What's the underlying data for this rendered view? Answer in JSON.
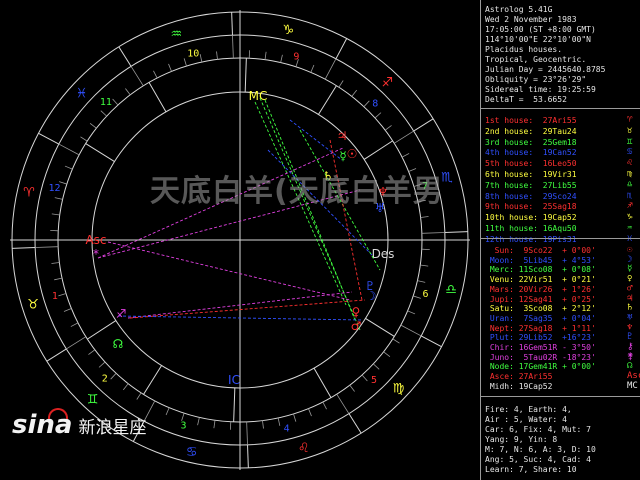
{
  "header": {
    "lines": [
      "Astrolog 5.41G",
      "Wed 2 November 1983",
      "17:05:00 (ST +8:00 GMT)",
      "114°10'00\"E 22°10'00\"N",
      "Placidus houses.",
      "Tropical, Geocentric.",
      "Julian Day = 2445640.8785",
      "Obliquity = 23°26'29\"",
      "Sidereal time: 19:25:59",
      "DeltaT =  53.6652"
    ]
  },
  "houses": [
    {
      "label": "1st house:",
      "value": "27Ari55",
      "color": "#ff3030",
      "glyph": "♈"
    },
    {
      "label": "2nd house:",
      "value": "29Tau24",
      "color": "#ffff40",
      "glyph": "♉"
    },
    {
      "label": "3rd house:",
      "value": "25Gem18",
      "color": "#40ff40",
      "glyph": "♊"
    },
    {
      "label": "4th house:",
      "value": "19Can52",
      "color": "#3050ff",
      "glyph": "♋"
    },
    {
      "label": "5th house:",
      "value": "16Leo50",
      "color": "#ff3030",
      "glyph": "♌"
    },
    {
      "label": "6th house:",
      "value": "19Vir31",
      "color": "#ffff40",
      "glyph": "♍"
    },
    {
      "label": "7th house:",
      "value": "27Lib55",
      "color": "#40ff40",
      "glyph": "♎"
    },
    {
      "label": "8th house:",
      "value": "29Sco24",
      "color": "#3050ff",
      "glyph": "♏"
    },
    {
      "label": "9th house:",
      "value": "25Sag18",
      "color": "#ff3030",
      "glyph": "♐"
    },
    {
      "label": "10th house:",
      "value": "19Cap52",
      "color": "#ffff40",
      "glyph": "♑"
    },
    {
      "label": "11th house:",
      "value": "16Aqu50",
      "color": "#40ff40",
      "glyph": "♒"
    },
    {
      "label": "12th house:",
      "value": "19Pis31",
      "color": "#3050ff",
      "glyph": "♓"
    }
  ],
  "planets": [
    {
      "name": "Sun:",
      "pos": "  9Sco22",
      "aspect": " + 0°00'",
      "color": "#ff3030",
      "glyph": "☉"
    },
    {
      "name": "Moon:",
      "pos": "  5Lib45",
      "aspect": " + 4°53'",
      "color": "#3050ff",
      "glyph": "☽"
    },
    {
      "name": "Merc:",
      "pos": " 11Sco08",
      "aspect": " + 0°08'",
      "color": "#40ff40",
      "glyph": "☿"
    },
    {
      "name": "Venu:",
      "pos": " 22Vir51",
      "aspect": " + 0°21'",
      "color": "#ffff40",
      "glyph": "♀"
    },
    {
      "name": "Mars:",
      "pos": " 20Vir26",
      "aspect": " + 1°26'",
      "color": "#ff3030",
      "glyph": "♂"
    },
    {
      "name": "Jupi:",
      "pos": " 12Sag41",
      "aspect": " + 0°25'",
      "color": "#ff3030",
      "glyph": "♃"
    },
    {
      "name": "Satu:",
      "pos": "  3Sco08",
      "aspect": " + 2°12'",
      "color": "#ffff40",
      "glyph": "♄"
    },
    {
      "name": "Uran:",
      "pos": "  7Sag35",
      "aspect": " + 0°04'",
      "color": "#3050ff",
      "glyph": "♅"
    },
    {
      "name": "Nept:",
      "pos": " 27Sag18",
      "aspect": " + 1°11'",
      "color": "#ff3030",
      "glyph": "♆"
    },
    {
      "name": "Plut:",
      "pos": " 29Lib52",
      "aspect": " +16°23'",
      "color": "#3050ff",
      "glyph": "♇"
    },
    {
      "name": "Chir:",
      "pos": " 16Gem51R",
      "aspect": " - 3°50'",
      "color": "#e040e0",
      "glyph": "⚷"
    },
    {
      "name": "Juno:",
      "pos": "  5Tau02R",
      "aspect": " -18°23'",
      "color": "#e040e0",
      "glyph": "⚵"
    },
    {
      "name": "Node:",
      "pos": " 17Gem41R",
      "aspect": " + 0°00'",
      "color": "#40ff40",
      "glyph": "☊"
    },
    {
      "name": "Asce:",
      "pos": " 27Ari55",
      "aspect": "",
      "color": "#ff3030",
      "glyph": "Asc"
    },
    {
      "name": "Midh:",
      "pos": " 19Cap52",
      "aspect": "",
      "color": "#e6e6e6",
      "glyph": "MC"
    }
  ],
  "summary": [
    "Fire: 4, Earth: 4,",
    "Air : 5, Water: 4",
    "Car: 6, Fix: 4, Mut: 7",
    "Yang: 9, Yin: 8",
    "M: 7, N: 6, A: 3, D: 10",
    "Ang: 5, Suc: 4, Cad: 4",
    "Learn: 7, Share: 10"
  ],
  "wheel": {
    "house_numbers": [
      "1",
      "2",
      "3",
      "4",
      "5",
      "6",
      "7",
      "8",
      "9",
      "10",
      "11",
      "12"
    ],
    "house_colors": [
      "#ff3030",
      "#ffff40",
      "#40ff40",
      "#3050ff",
      "#ff3030",
      "#ffff40",
      "#40ff40",
      "#3050ff",
      "#ff3030",
      "#ffff40",
      "#40ff40",
      "#3050ff"
    ],
    "sign_glyphs": [
      "♈",
      "♉",
      "♊",
      "♋",
      "♌",
      "♍",
      "♎",
      "♏",
      "♐",
      "♑",
      "♒",
      "♓"
    ],
    "sign_colors": [
      "#ff3030",
      "#ffff40",
      "#40ff40",
      "#3050ff",
      "#ff3030",
      "#ffff40",
      "#40ff40",
      "#3050ff",
      "#ff3030",
      "#ffff40",
      "#40ff40",
      "#3050ff"
    ],
    "angle_labels": {
      "asc": "Asc",
      "mc": "MC",
      "desc": "Des",
      "ic": "IC"
    }
  },
  "overlay": {
    "banner": "天底白羊(天底白羊男",
    "watermark_logo": "sina",
    "watermark_text": "新浪星座"
  }
}
